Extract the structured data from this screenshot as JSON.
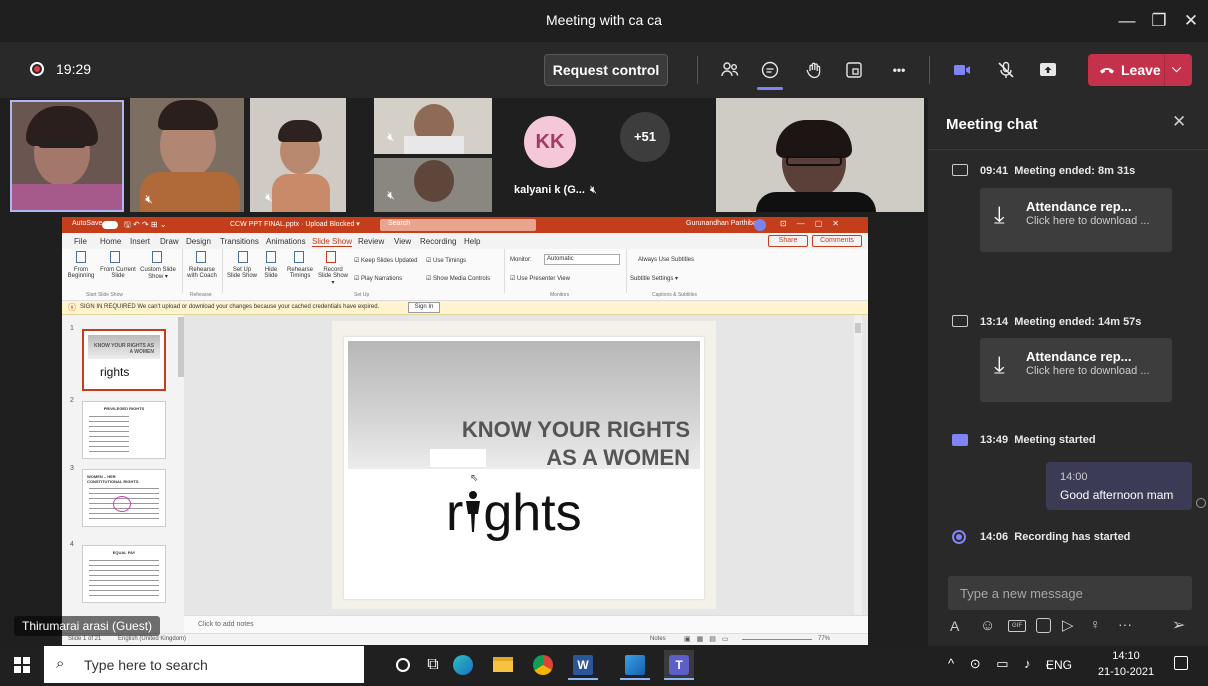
{
  "window": {
    "title": "Meeting with ca ca",
    "min": "—",
    "max": "❐",
    "close": "✕"
  },
  "toolbar": {
    "timer": "19:29",
    "request_control": "Request control",
    "leave": "Leave",
    "more": "•••"
  },
  "participants": {
    "kk_initials": "KK",
    "kk_name": "kalyani k (G...",
    "more_count": "+51",
    "speaker_name": "Thirumarai arasi (Guest)"
  },
  "ppt": {
    "titlebar": {
      "autosave": "AutoSave",
      "filename": "CCW PPT FINAL.pptx · Upload Blocked ▾",
      "search": "Search",
      "user": "Gurunandhan Parthiban"
    },
    "menu": [
      "File",
      "Home",
      "Insert",
      "Draw",
      "Design",
      "Transitions",
      "Animations",
      "Slide Show",
      "Review",
      "View",
      "Recording",
      "Help"
    ],
    "share": "Share",
    "comments": "Comments",
    "ribbon": {
      "from_beginning": "From Beginning",
      "from_current": "From Current Slide",
      "custom_show": "Custom Slide Show ▾",
      "rehearse_coach": "Rehearse with Coach",
      "setup_show": "Set Up Slide Show",
      "hide_slide": "Hide Slide",
      "rehearse_timings": "Rehearse Timings",
      "record_show": "Record Slide Show ▾",
      "keep_updated": "Keep Slides Updated",
      "use_timings": "Use Timings",
      "play_narrations": "Play Narrations",
      "show_media": "Show Media Controls",
      "monitor": "Monitor:",
      "monitor_value": "Automatic",
      "presenter_view": "Use Presenter View",
      "always_subtitles": "Always Use Subtitles",
      "subtitle_settings": "Subtitle Settings ▾",
      "groups": [
        "Start Slide Show",
        "Rehearse",
        "Set Up",
        "Monitors",
        "Captions & Subtitles"
      ]
    },
    "signin_bar": {
      "message": "SIGN IN REQUIRED  We can't upload or download your changes because your cached credentials have expired.",
      "button": "Sign In"
    },
    "thumbs": [
      {
        "num": "1",
        "title": "KNOW YOUR RIGHTS AS A WOMEN",
        "word": "rights"
      },
      {
        "num": "2",
        "title": "PRIVILEGED RIGHTS"
      },
      {
        "num": "3",
        "title": "WOMEN – HER CONSTITUTIONAL RIGHTS"
      },
      {
        "num": "4",
        "title": "EQUAL PAY"
      }
    ],
    "slide": {
      "line1": "KNOW YOUR RIGHTS",
      "line2": "AS A WOMEN",
      "word_pre": "r",
      "word_post": "ghts"
    },
    "notes": "Click to add notes",
    "status": {
      "slide_of": "Slide 1 of 21",
      "lang": "English (United Kingdom)",
      "notes_btn": "Notes",
      "zoom": "77%"
    }
  },
  "chat": {
    "title": "Meeting chat",
    "events": [
      {
        "time": "09:41",
        "text": "Meeting ended: 8m 31s"
      },
      {
        "time": "13:14",
        "text": "Meeting ended: 14m 57s"
      },
      {
        "time": "13:49",
        "text": "Meeting started"
      },
      {
        "time": "14:06",
        "text": "Recording has started"
      }
    ],
    "attachments": [
      {
        "title": "Attendance rep...",
        "sub": "Click here to download ..."
      },
      {
        "title": "Attendance rep...",
        "sub": "Click here to download ..."
      }
    ],
    "message": {
      "time": "14:00",
      "text": "Good afternoon mam"
    },
    "placeholder": "Type a new message"
  },
  "taskbar": {
    "search_placeholder": "Type here to search",
    "lang": "ENG",
    "time": "14:10",
    "date": "21-10-2021"
  },
  "colors": {
    "teams_bg": "#292929",
    "leave_red": "#c4314b",
    "ppt_orange": "#c43e1c",
    "chat_bubble": "#3b3b56",
    "accent": "#7f85f5"
  }
}
